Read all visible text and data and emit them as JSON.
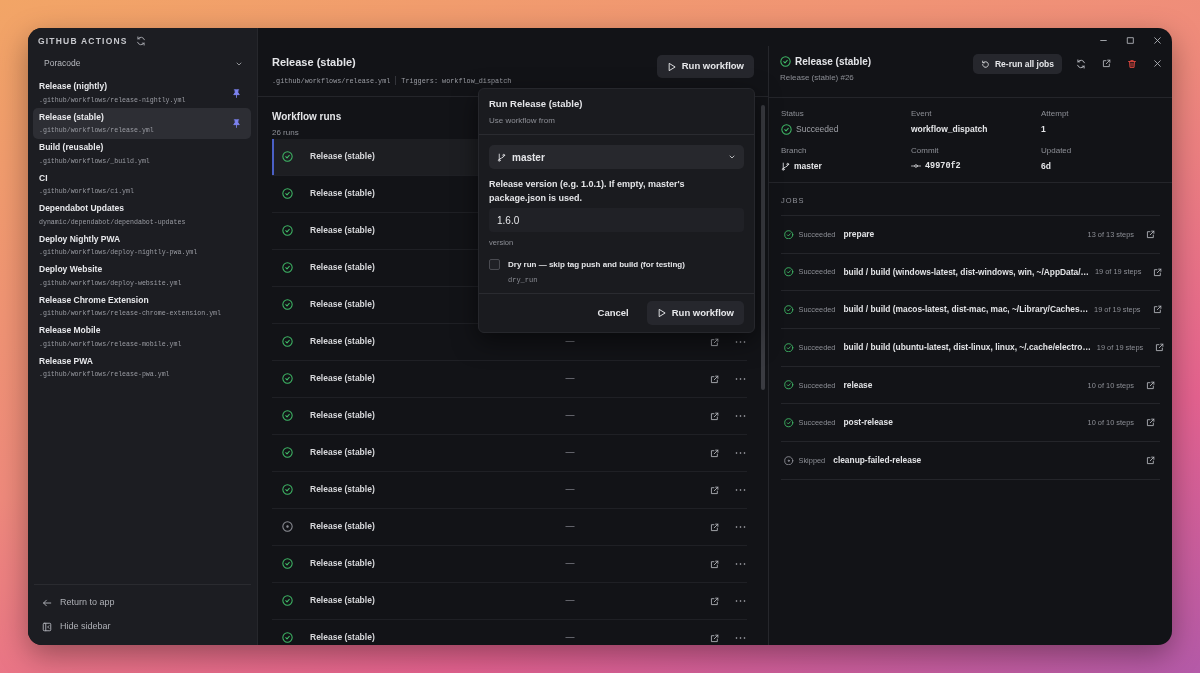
{
  "window": {
    "title": "GITHUB ACTIONS"
  },
  "sidebar": {
    "repo_select": "Poracode",
    "items": [
      {
        "name": "Release (nightly)",
        "path": ".github/workflows/release-nightly.yml",
        "pinned": true,
        "selected": false
      },
      {
        "name": "Release (stable)",
        "path": ".github/workflows/release.yml",
        "pinned": true,
        "selected": true
      },
      {
        "name": "Build (reusable)",
        "path": ".github/workflows/_build.yml",
        "pinned": false,
        "selected": false
      },
      {
        "name": "CI",
        "path": ".github/workflows/ci.yml",
        "pinned": false,
        "selected": false
      },
      {
        "name": "Dependabot Updates",
        "path": "dynamic/dependabot/dependabot-updates",
        "pinned": false,
        "selected": false
      },
      {
        "name": "Deploy Nightly PWA",
        "path": ".github/workflows/deploy-nightly-pwa.yml",
        "pinned": false,
        "selected": false
      },
      {
        "name": "Deploy Website",
        "path": ".github/workflows/deploy-website.yml",
        "pinned": false,
        "selected": false
      },
      {
        "name": "Release Chrome Extension",
        "path": ".github/workflows/release-chrome-extension.yml",
        "pinned": false,
        "selected": false
      },
      {
        "name": "Release Mobile",
        "path": ".github/workflows/release-mobile.yml",
        "pinned": false,
        "selected": false
      },
      {
        "name": "Release PWA",
        "path": ".github/workflows/release-pwa.yml",
        "pinned": false,
        "selected": false
      }
    ],
    "footer": [
      {
        "kind": "back",
        "label": "Return to app"
      },
      {
        "kind": "sidebar",
        "label": "Hide sidebar"
      }
    ]
  },
  "workflow": {
    "title": "Release (stable)",
    "path": ".github/workflows/release.yml",
    "triggers": "Triggers: workflow_dispatch",
    "run_button": "Run workflow"
  },
  "runs": {
    "title": "Workflow runs",
    "count": "26 runs",
    "rows": [
      {
        "skipped": false,
        "name": "Release (stable)",
        "selected": true
      },
      {
        "skipped": false,
        "name": "Release (stable)",
        "selected": false
      },
      {
        "skipped": false,
        "name": "Release (stable)",
        "selected": false
      },
      {
        "skipped": false,
        "name": "Release (stable)",
        "selected": false
      },
      {
        "skipped": false,
        "name": "Release (stable)",
        "selected": false
      },
      {
        "skipped": false,
        "name": "Release (stable)",
        "selected": false,
        "duration": "—"
      },
      {
        "skipped": false,
        "name": "Release (stable)",
        "selected": false,
        "duration": "—"
      },
      {
        "skipped": false,
        "name": "Release (stable)",
        "selected": false,
        "duration": "—"
      },
      {
        "skipped": false,
        "name": "Release (stable)",
        "selected": false,
        "duration": "—"
      },
      {
        "skipped": false,
        "name": "Release (stable)",
        "selected": false,
        "duration": "—"
      },
      {
        "skipped": true,
        "name": "Release (stable)",
        "selected": false,
        "duration": "—"
      },
      {
        "skipped": false,
        "name": "Release (stable)",
        "selected": false,
        "duration": "—"
      },
      {
        "skipped": false,
        "name": "Release (stable)",
        "selected": false,
        "duration": "—"
      },
      {
        "skipped": false,
        "name": "Release (stable)",
        "selected": false,
        "duration": "—"
      }
    ]
  },
  "run_dialog": {
    "title": "Run Release (stable)",
    "subtitle": "Use workflow from",
    "branch": "master",
    "field_label": "Release version (e.g. 1.0.1). If empty, master's package.json is used.",
    "value": "1.6.0",
    "hint": "version",
    "checkbox": {
      "label": "Dry run — skip tag push and build (for testing)",
      "name": "dry_run",
      "checked": false
    },
    "cancel_button": "Cancel",
    "run_button": "Run workflow"
  },
  "run_detail": {
    "skipped": false,
    "title": "Release (stable)",
    "subtitle": "Release (stable) #26",
    "rerun_button": "Re-run all jobs",
    "fields": [
      {
        "label": "Status",
        "value": "Succeeded",
        "kind": "status"
      },
      {
        "label": "Event",
        "value": "workflow_dispatch",
        "kind": "text"
      },
      {
        "label": "Attempt",
        "value": "1",
        "kind": "text"
      },
      {
        "label": "Branch",
        "value": "master",
        "kind": "branch"
      },
      {
        "label": "Commit",
        "value": "49970f2",
        "kind": "commit"
      },
      {
        "label": "Updated",
        "value": "6d",
        "kind": "text"
      }
    ],
    "jobs_heading": "JOBS",
    "jobs": [
      {
        "skipped": false,
        "status_text": "Succeeded",
        "name": "prepare",
        "steps": "13 of 13 steps"
      },
      {
        "skipped": false,
        "status_text": "Succeeded",
        "name": "build / build (windows-latest, dist-windows, win, ~/AppData/…",
        "steps": "19 of 19 steps"
      },
      {
        "skipped": false,
        "status_text": "Succeeded",
        "name": "build / build (macos-latest, dist-mac, mac, ~/Library/Caches…",
        "steps": "19 of 19 steps"
      },
      {
        "skipped": false,
        "status_text": "Succeeded",
        "name": "build / build (ubuntu-latest, dist-linux, linux, ~/.cache/electro…",
        "steps": "19 of 19 steps"
      },
      {
        "skipped": false,
        "status_text": "Succeeded",
        "name": "release",
        "steps": "10 of 10 steps"
      },
      {
        "skipped": false,
        "status_text": "Succeeded",
        "name": "post-release",
        "steps": "10 of 10 steps"
      },
      {
        "skipped": true,
        "status_text": "Skipped",
        "name": "cleanup-failed-release"
      }
    ]
  }
}
